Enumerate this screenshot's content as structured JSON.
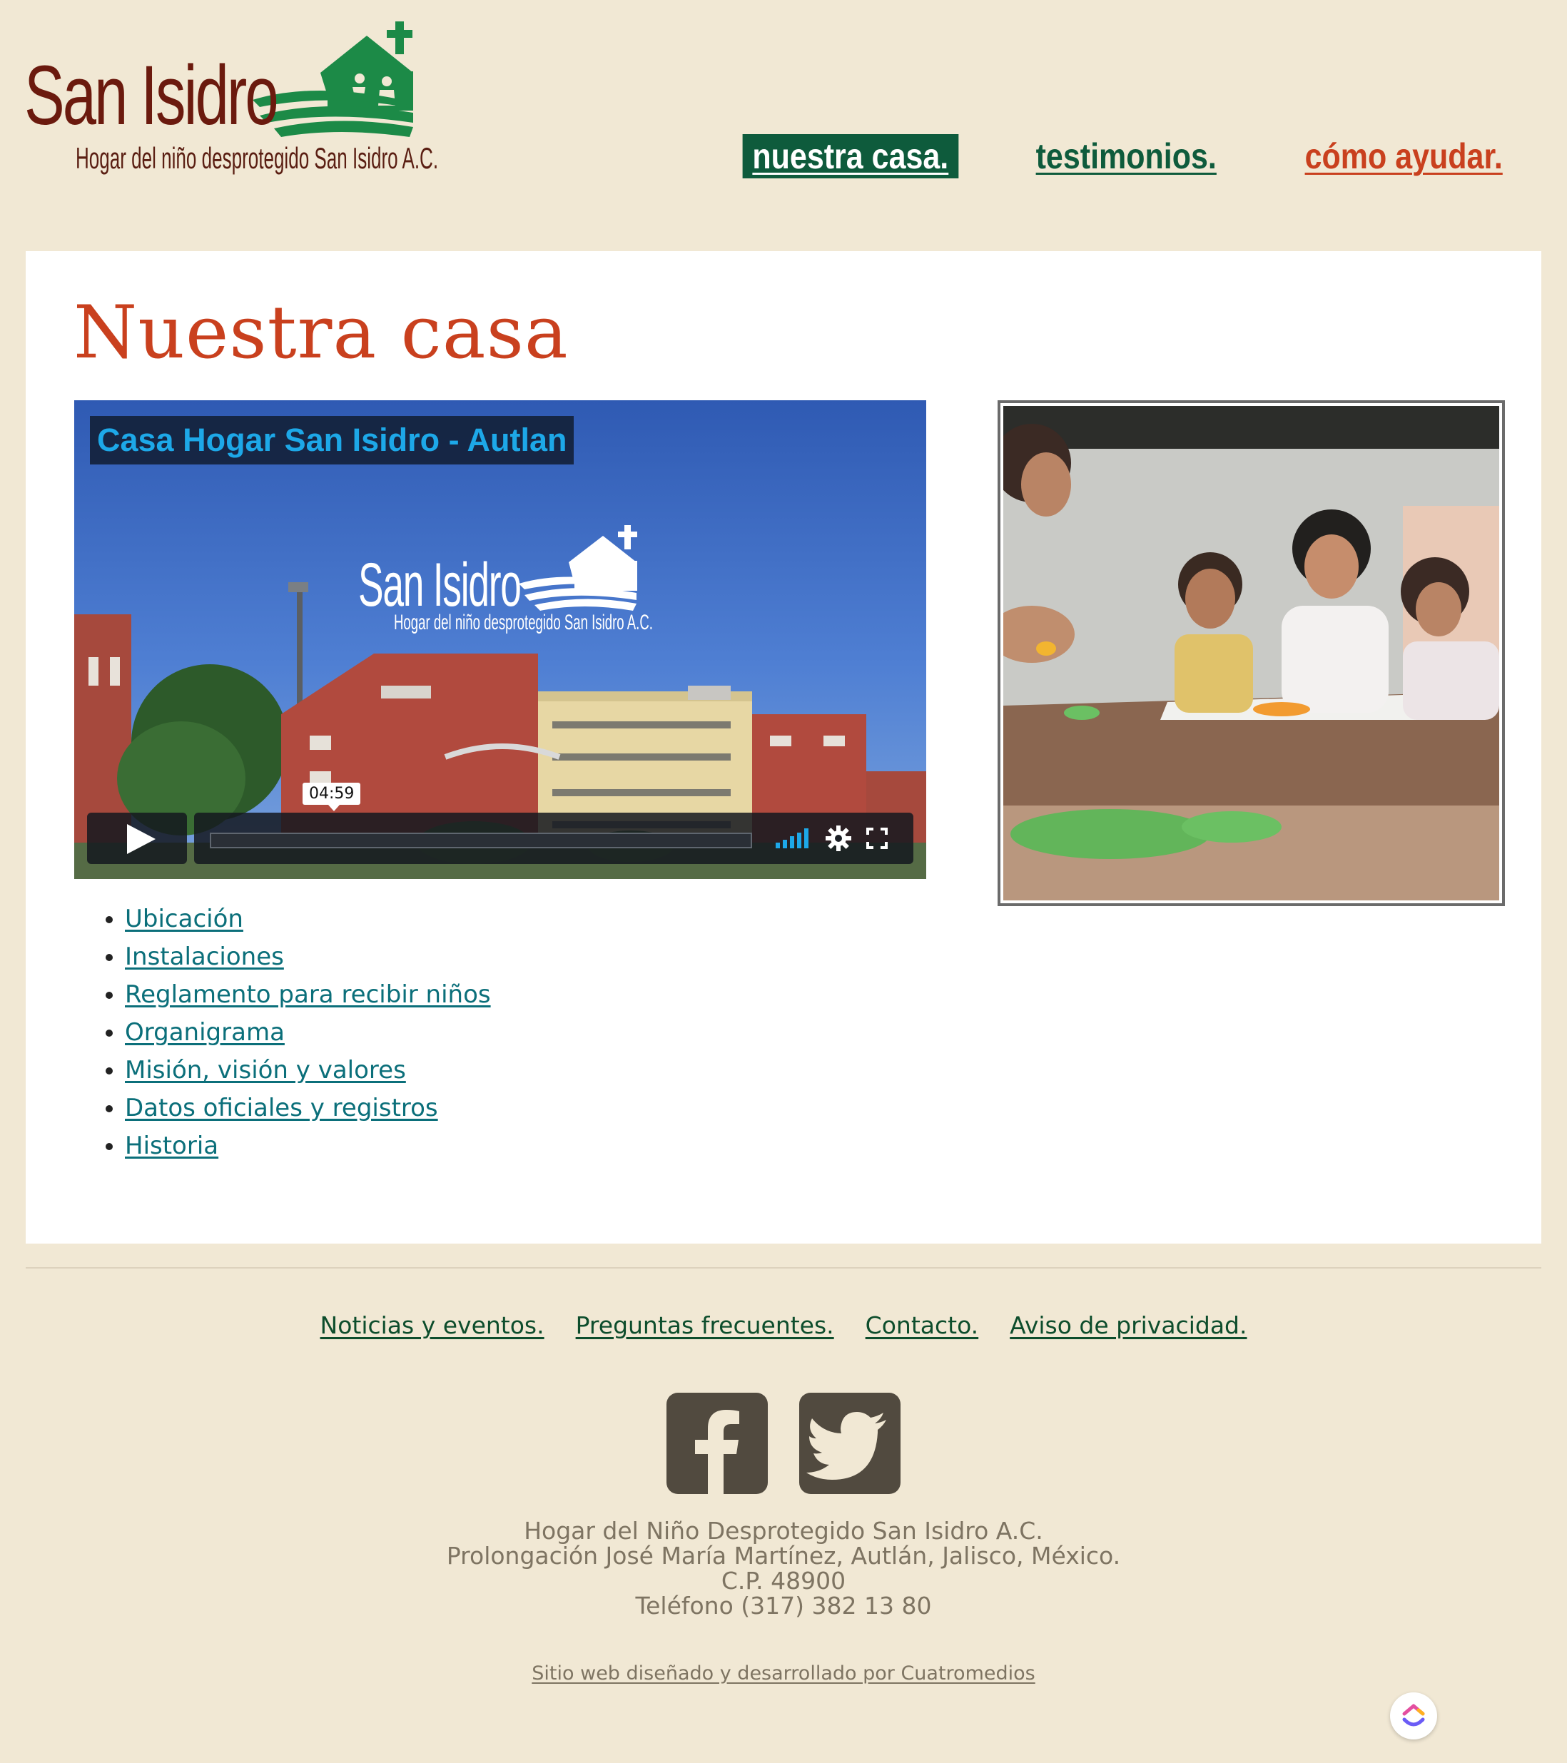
{
  "header": {
    "logo_title": "San Isidro",
    "logo_subtitle": "Hogar del niño desprotegido San Isidro A.C.",
    "nav": [
      {
        "label": "nuestra casa."
      },
      {
        "label": "testimonios."
      },
      {
        "label": "cómo ayudar."
      }
    ]
  },
  "main": {
    "title": "Nuestra casa",
    "video": {
      "title": "Casa Hogar San Isidro - Autlan",
      "logo_title": "San Isidro",
      "logo_subtitle": "Hogar del niño desprotegido San Isidro A.C.",
      "duration": "04:59"
    },
    "links": [
      {
        "label": "Ubicación"
      },
      {
        "label": "Instalaciones"
      },
      {
        "label": "Reglamento para recibir niños"
      },
      {
        "label": "Organigrama"
      },
      {
        "label": "Misión, visión y valores"
      },
      {
        "label": "Datos oficiales y registros"
      },
      {
        "label": "Historia"
      }
    ]
  },
  "footer": {
    "nav": [
      {
        "label": "Noticias y eventos."
      },
      {
        "label": "Preguntas frecuentes."
      },
      {
        "label": "Contacto."
      },
      {
        "label": "Aviso de privacidad."
      }
    ],
    "social": [
      {
        "icon": "facebook-icon"
      },
      {
        "icon": "twitter-icon"
      }
    ],
    "address": [
      "Hogar del Niño Desprotegido San Isidro A.C.",
      "Prolongación José María Martínez, Autlán, Jalisco, México.",
      "C.P. 48900",
      "Teléfono (317) 382 13 80"
    ],
    "credit": "Sitio web diseñado y desarrollado por Cuatromedios"
  },
  "colors": {
    "background": "#f1e8d4",
    "brand_green": "#0e5b3c",
    "accent_red": "#c9401e",
    "logo_brown": "#6b1a0e",
    "link_teal": "#0b6f7a"
  }
}
